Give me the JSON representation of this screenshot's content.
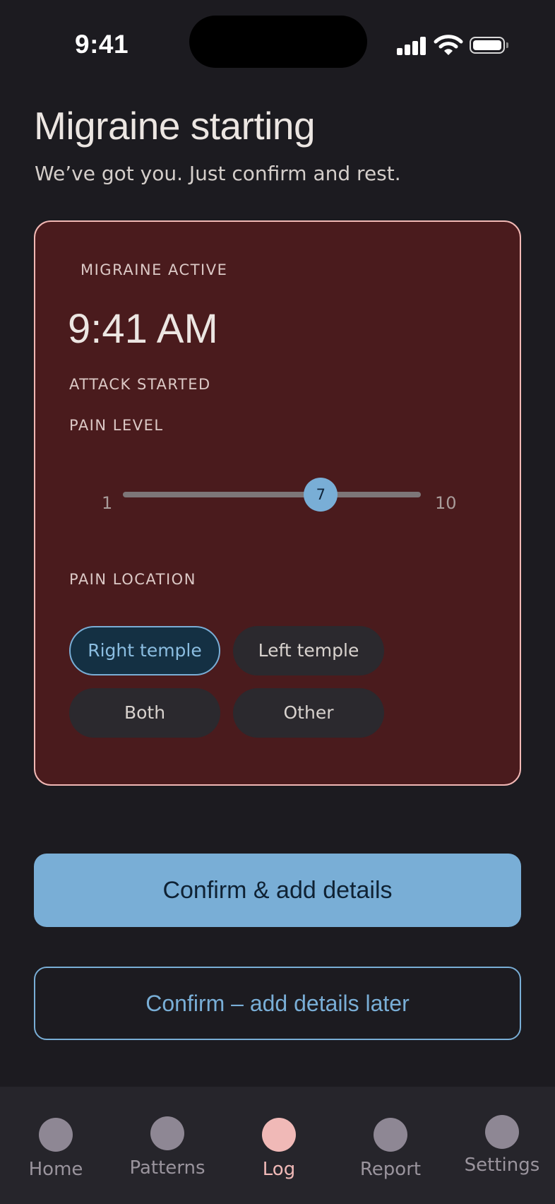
{
  "status_bar": {
    "time": "9:41"
  },
  "header": {
    "title": "Migraine starting",
    "subtitle": "We’ve got you. Just confirm and rest."
  },
  "card": {
    "status_label": "MIGRAINE ACTIVE",
    "time": "9:41 AM",
    "time_caption": "ATTACK STARTED",
    "pain_level": {
      "label": "PAIN LEVEL",
      "min": "1",
      "max": "10",
      "value": "7"
    },
    "pain_location": {
      "label": "PAIN LOCATION",
      "options": [
        {
          "label": "Right temple",
          "selected": true
        },
        {
          "label": "Left temple",
          "selected": false
        },
        {
          "label": "Both",
          "selected": false
        },
        {
          "label": "Other",
          "selected": false
        }
      ]
    }
  },
  "actions": {
    "primary_label": "Confirm & add details",
    "secondary_label": "Confirm – add details later"
  },
  "bottom_nav": {
    "active": "Log",
    "items": [
      {
        "label": "Home"
      },
      {
        "label": "Patterns"
      },
      {
        "label": "Log"
      },
      {
        "label": "Report"
      },
      {
        "label": "Settings"
      }
    ]
  },
  "colors": {
    "background": "#1c1b20",
    "card_background": "#4a1b1d",
    "card_border": "#f2b8b5",
    "accent": "#79aed6",
    "active_nav": "#f0b9b7"
  }
}
